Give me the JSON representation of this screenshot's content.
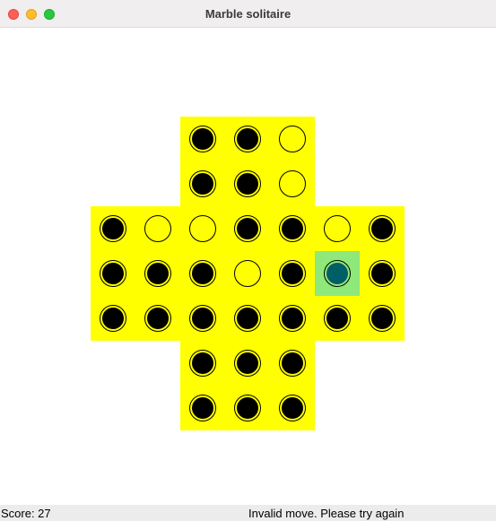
{
  "window": {
    "title": "Marble solitaire"
  },
  "colors": {
    "board": "#ffff00",
    "marble": "#000000",
    "selected_cell": "#8fe87a",
    "selected_marble": "#005f66"
  },
  "board": {
    "rows": [
      [
        "",
        "",
        "marble",
        "marble",
        "empty",
        "",
        ""
      ],
      [
        "",
        "",
        "marble",
        "marble",
        "empty",
        "",
        ""
      ],
      [
        "marble",
        "empty",
        "empty",
        "marble",
        "marble",
        "empty",
        "marble"
      ],
      [
        "marble",
        "marble",
        "marble",
        "empty",
        "marble",
        "selected",
        "marble"
      ],
      [
        "marble",
        "marble",
        "marble",
        "marble",
        "marble",
        "marble",
        "marble"
      ],
      [
        "",
        "",
        "marble",
        "marble",
        "marble",
        "",
        ""
      ],
      [
        "",
        "",
        "marble",
        "marble",
        "marble",
        "",
        ""
      ]
    ]
  },
  "status": {
    "score": "Score: 27",
    "message": "Invalid move. Please try again"
  }
}
